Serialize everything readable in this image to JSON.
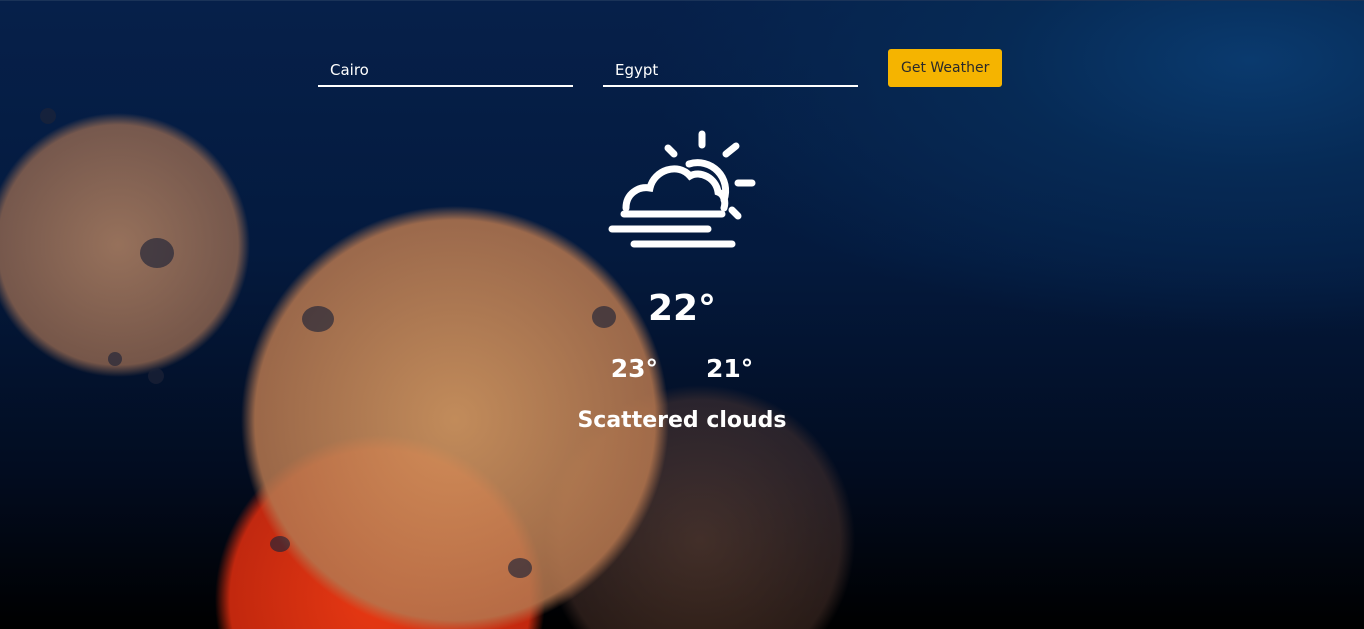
{
  "form": {
    "city_value": "Cairo",
    "country_value": "Egypt",
    "submit_label": "Get Weather"
  },
  "weather": {
    "icon": "partly-cloudy-icon",
    "temperature": "22°",
    "temp_max": "23°",
    "temp_min": "21°",
    "description": "Scattered clouds"
  },
  "colors": {
    "accent": "#f5b400",
    "text": "#ffffff",
    "background": "#041a3e"
  }
}
